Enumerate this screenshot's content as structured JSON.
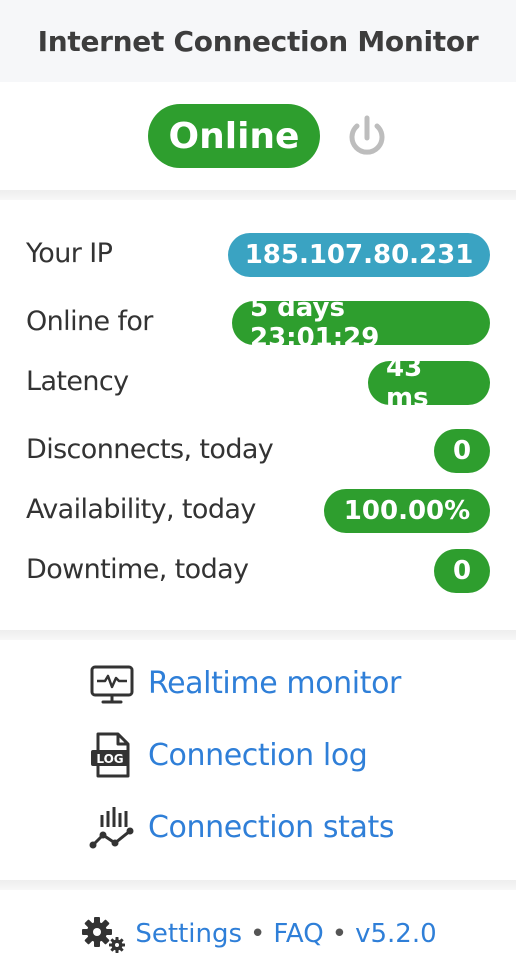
{
  "app": {
    "title": "Internet Connection Monitor"
  },
  "status": {
    "label": "Online",
    "power_icon": "power-icon"
  },
  "stats": [
    {
      "label": "Your IP",
      "value": "185.107.80.231",
      "color": "#3aa3c2"
    },
    {
      "label": "Online for",
      "value": "5 days 23:01:29",
      "color": "#2e9e2e"
    },
    {
      "label": "Latency",
      "value": "43 ms",
      "color": "#2e9e2e"
    },
    {
      "label": "Disconnects, today",
      "value": "0",
      "color": "#2e9e2e"
    },
    {
      "label": "Availability, today",
      "value": "100.00%",
      "color": "#2e9e2e"
    },
    {
      "label": "Downtime, today",
      "value": "0",
      "color": "#2e9e2e"
    }
  ],
  "links": {
    "realtime": {
      "label": "Realtime monitor",
      "icon": "monitor-icon"
    },
    "log": {
      "label": "Connection log",
      "icon": "log-file-icon"
    },
    "stats": {
      "label": "Connection stats",
      "icon": "stats-chart-icon"
    }
  },
  "footer": {
    "settings": "Settings",
    "faq": "FAQ",
    "version": "v5.2.0",
    "separator": "•",
    "icon": "gears-icon"
  },
  "colors": {
    "accent": "#2f7fd8",
    "online": "#2e9e2e",
    "ip": "#3aa3c2"
  }
}
